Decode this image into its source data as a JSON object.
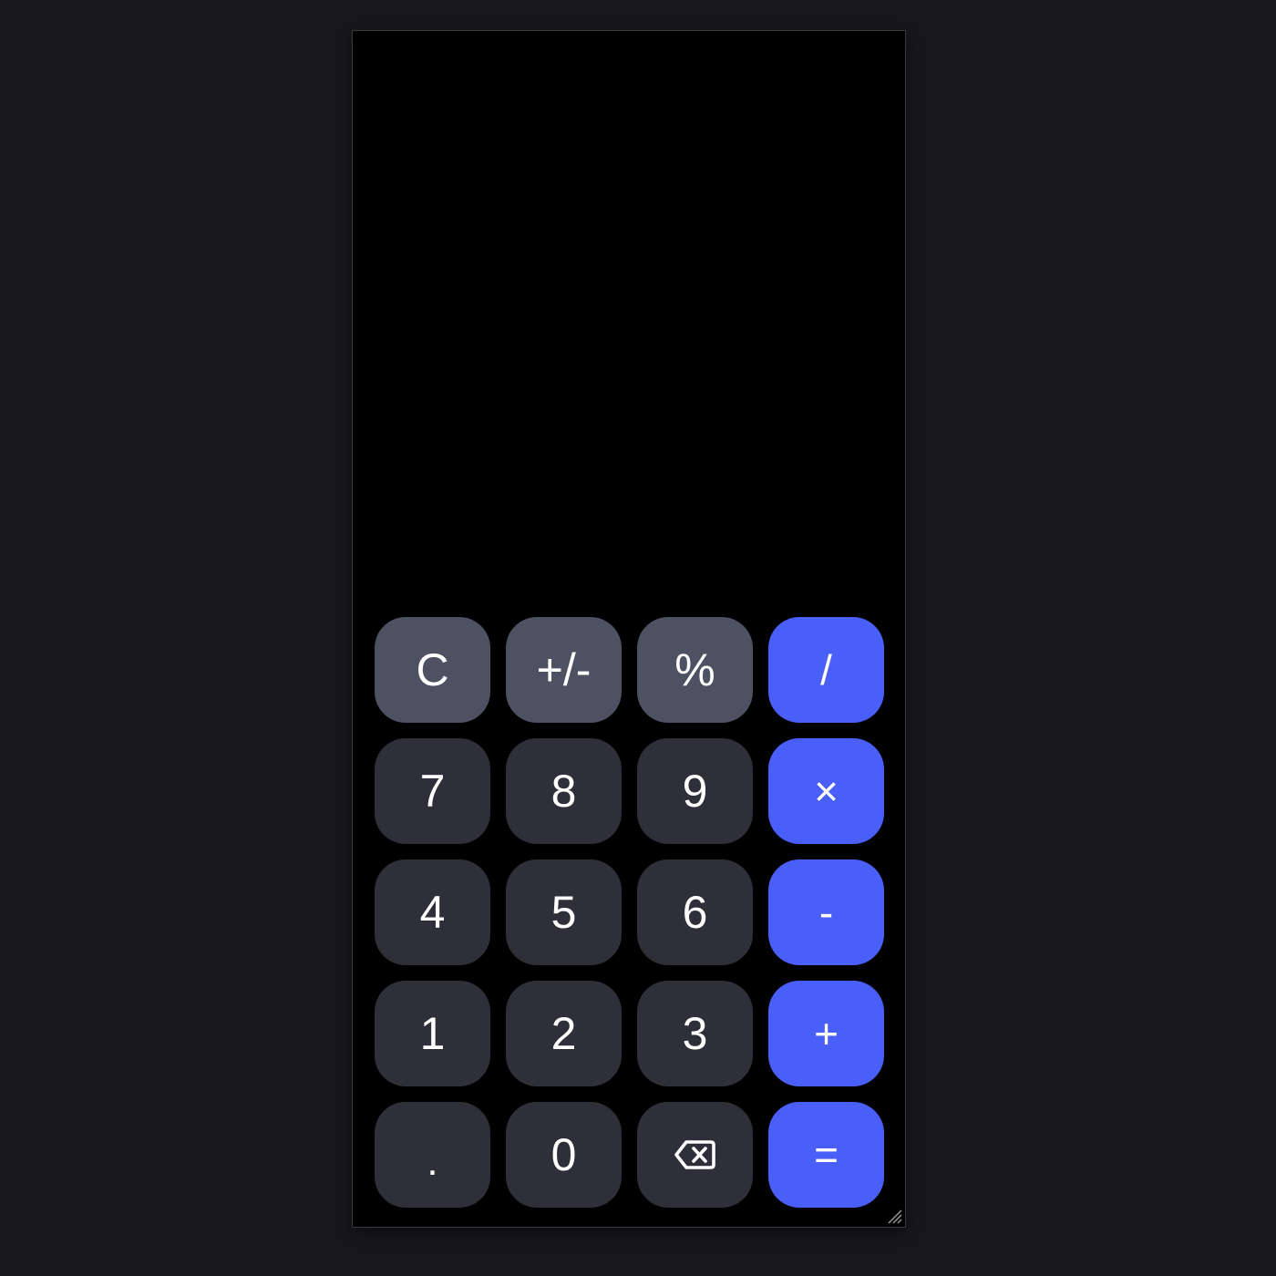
{
  "display": {
    "expression": "",
    "result": ""
  },
  "keypad": {
    "row1": {
      "clear": "C",
      "sign": "+/-",
      "percent": "%",
      "divide": "/"
    },
    "row2": {
      "seven": "7",
      "eight": "8",
      "nine": "9",
      "multiply": "×"
    },
    "row3": {
      "four": "4",
      "five": "5",
      "six": "6",
      "subtract": "-"
    },
    "row4": {
      "one": "1",
      "two": "2",
      "three": "3",
      "add": "+"
    },
    "row5": {
      "decimal": ".",
      "zero": "0",
      "backspace_icon": "backspace-icon",
      "equals": "="
    }
  },
  "colors": {
    "background": "#18181b",
    "screen": "#000000",
    "function_key": "#4e5162",
    "number_key": "#2f2f3a",
    "operator_key": "#4a5ef8",
    "key_text": "#ffffff"
  }
}
